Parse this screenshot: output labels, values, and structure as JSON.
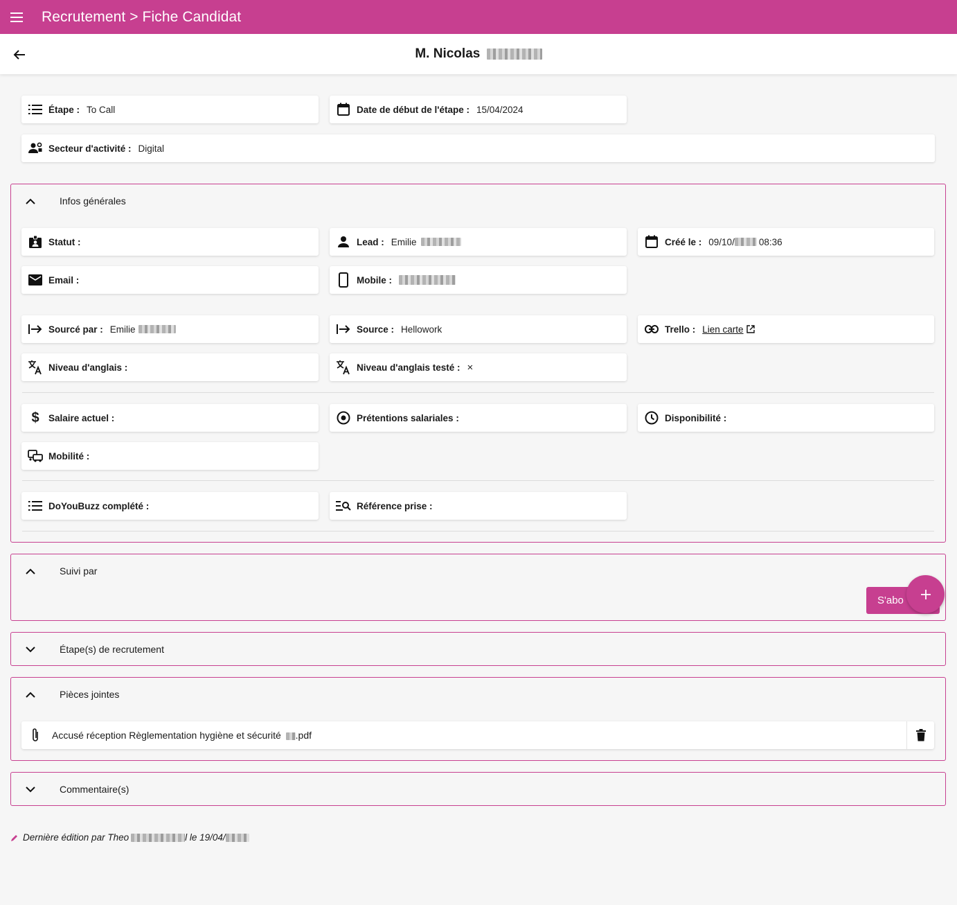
{
  "topbar": {
    "title": "Recrutement > Fiche Candidat"
  },
  "candidate": {
    "name": "M. Nicolas"
  },
  "summary": {
    "etape": {
      "label": "Étape :",
      "value": "To Call"
    },
    "date_debut": {
      "label": "Date de début de l'étape :",
      "value": "15/04/2024"
    },
    "secteur": {
      "label": "Secteur d'activité :",
      "value": "Digital"
    }
  },
  "infos": {
    "title": "Infos générales",
    "statut": {
      "label": "Statut :",
      "value": ""
    },
    "lead": {
      "label": "Lead :",
      "value": "Emilie"
    },
    "cree": {
      "label": "Créé le :",
      "date_prefix": "09/10/",
      "time": "08:36"
    },
    "email": {
      "label": "Email :",
      "value": ""
    },
    "mobile": {
      "label": "Mobile :"
    },
    "source_par": {
      "label": "Sourcé par :",
      "value": "Emilie"
    },
    "source": {
      "label": "Source :",
      "value": "Hellowork"
    },
    "trello": {
      "label": "Trello :",
      "link": "Lien carte"
    },
    "anglais": {
      "label": "Niveau d'anglais :"
    },
    "anglais_teste": {
      "label": "Niveau d'anglais testé :",
      "value": "×"
    },
    "salaire": {
      "label": "Salaire actuel :"
    },
    "pretentions": {
      "label": "Prétentions salariales :"
    },
    "disponibilite": {
      "label": "Disponibilité :"
    },
    "mobilite": {
      "label": "Mobilité :"
    },
    "doyoubuzz": {
      "label": "DoYouBuzz complété :"
    },
    "reference": {
      "label": "Référence prise :"
    }
  },
  "suivi": {
    "title": "Suivi par",
    "subscribe_label": "S'abo"
  },
  "etapes": {
    "title": "Étape(s) de recrutement"
  },
  "pieces": {
    "title": "Pièces jointes",
    "file_prefix": "Accusé réception Règlementation hygiène et sécurité",
    "file_suffix": ".pdf"
  },
  "commentaires": {
    "title": "Commentaire(s)"
  },
  "footer": {
    "prefix": "Dernière édition par Theo",
    "middle": "l le 19/04/"
  },
  "colors": {
    "accent": "#c73f90",
    "background": "#f6f6f6"
  }
}
